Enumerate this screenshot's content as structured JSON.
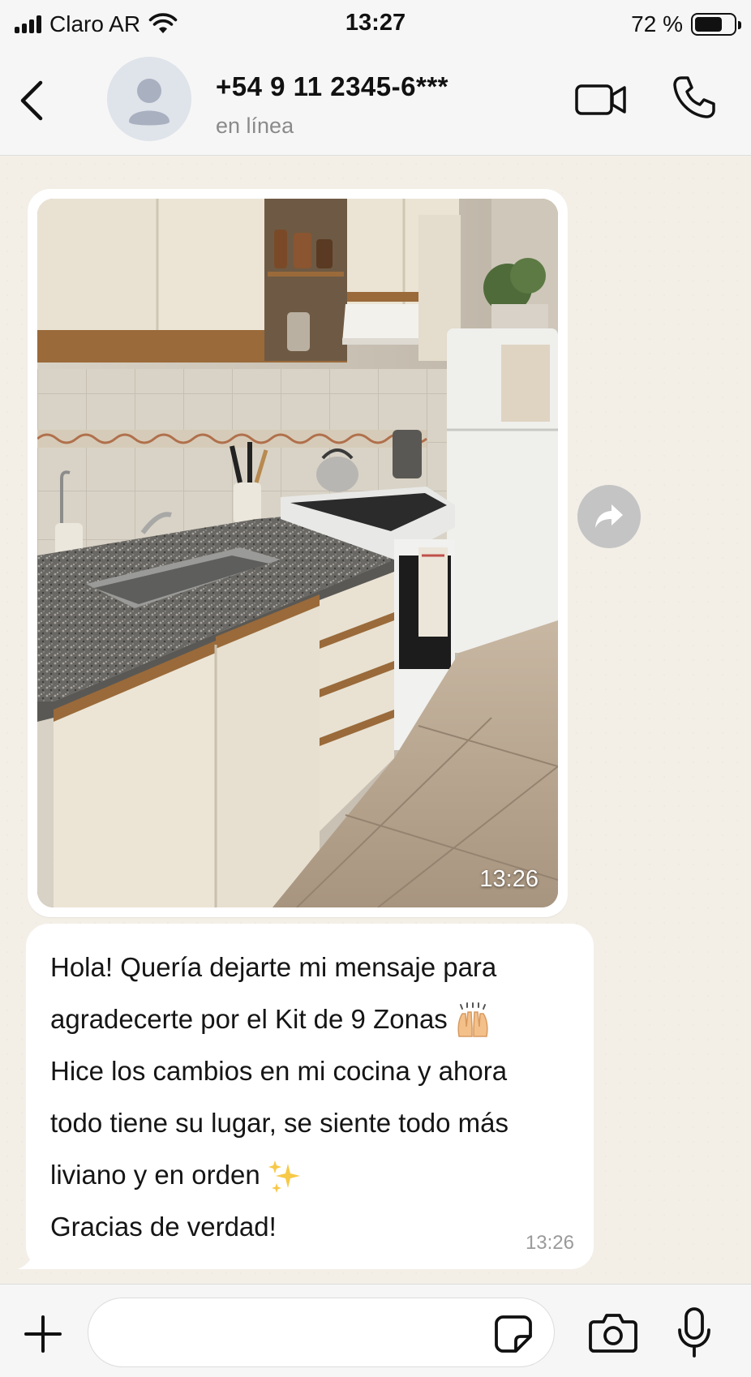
{
  "status_bar": {
    "carrier": "Claro AR",
    "time": "13:27",
    "battery_percent": "72 %",
    "battery_level": 0.72
  },
  "header": {
    "contact_name": "+54 9 11 2345-6***",
    "contact_status": "en línea",
    "icons": [
      "back-chevron-icon",
      "avatar-icon",
      "video-call-icon",
      "phone-icon"
    ]
  },
  "messages": {
    "photo": {
      "time": "13:26",
      "icon": "forward-icon"
    },
    "text": {
      "lines": [
        "Hola! Quería dejarte mi mensaje para",
        "agradecerte por el Kit de 9 Zonas",
        "Hice los cambios en mi cocina y ahora",
        "todo tiene su lugar, se siente todo más",
        "liviano y en orden",
        "Gracias de verdad!"
      ],
      "emojis": [
        "raised-hands-emoji",
        "sparkles-emoji"
      ],
      "time": "13:26"
    }
  },
  "input_bar": {
    "placeholder": "",
    "icons": [
      "plus-icon",
      "sticker-icon",
      "camera-icon",
      "microphone-icon"
    ]
  },
  "colors": {
    "chat_background": "#f3efe7",
    "bubble": "#ffffff",
    "bar_background": "#f6f6f6",
    "secondary_text": "#8a8a8a"
  }
}
